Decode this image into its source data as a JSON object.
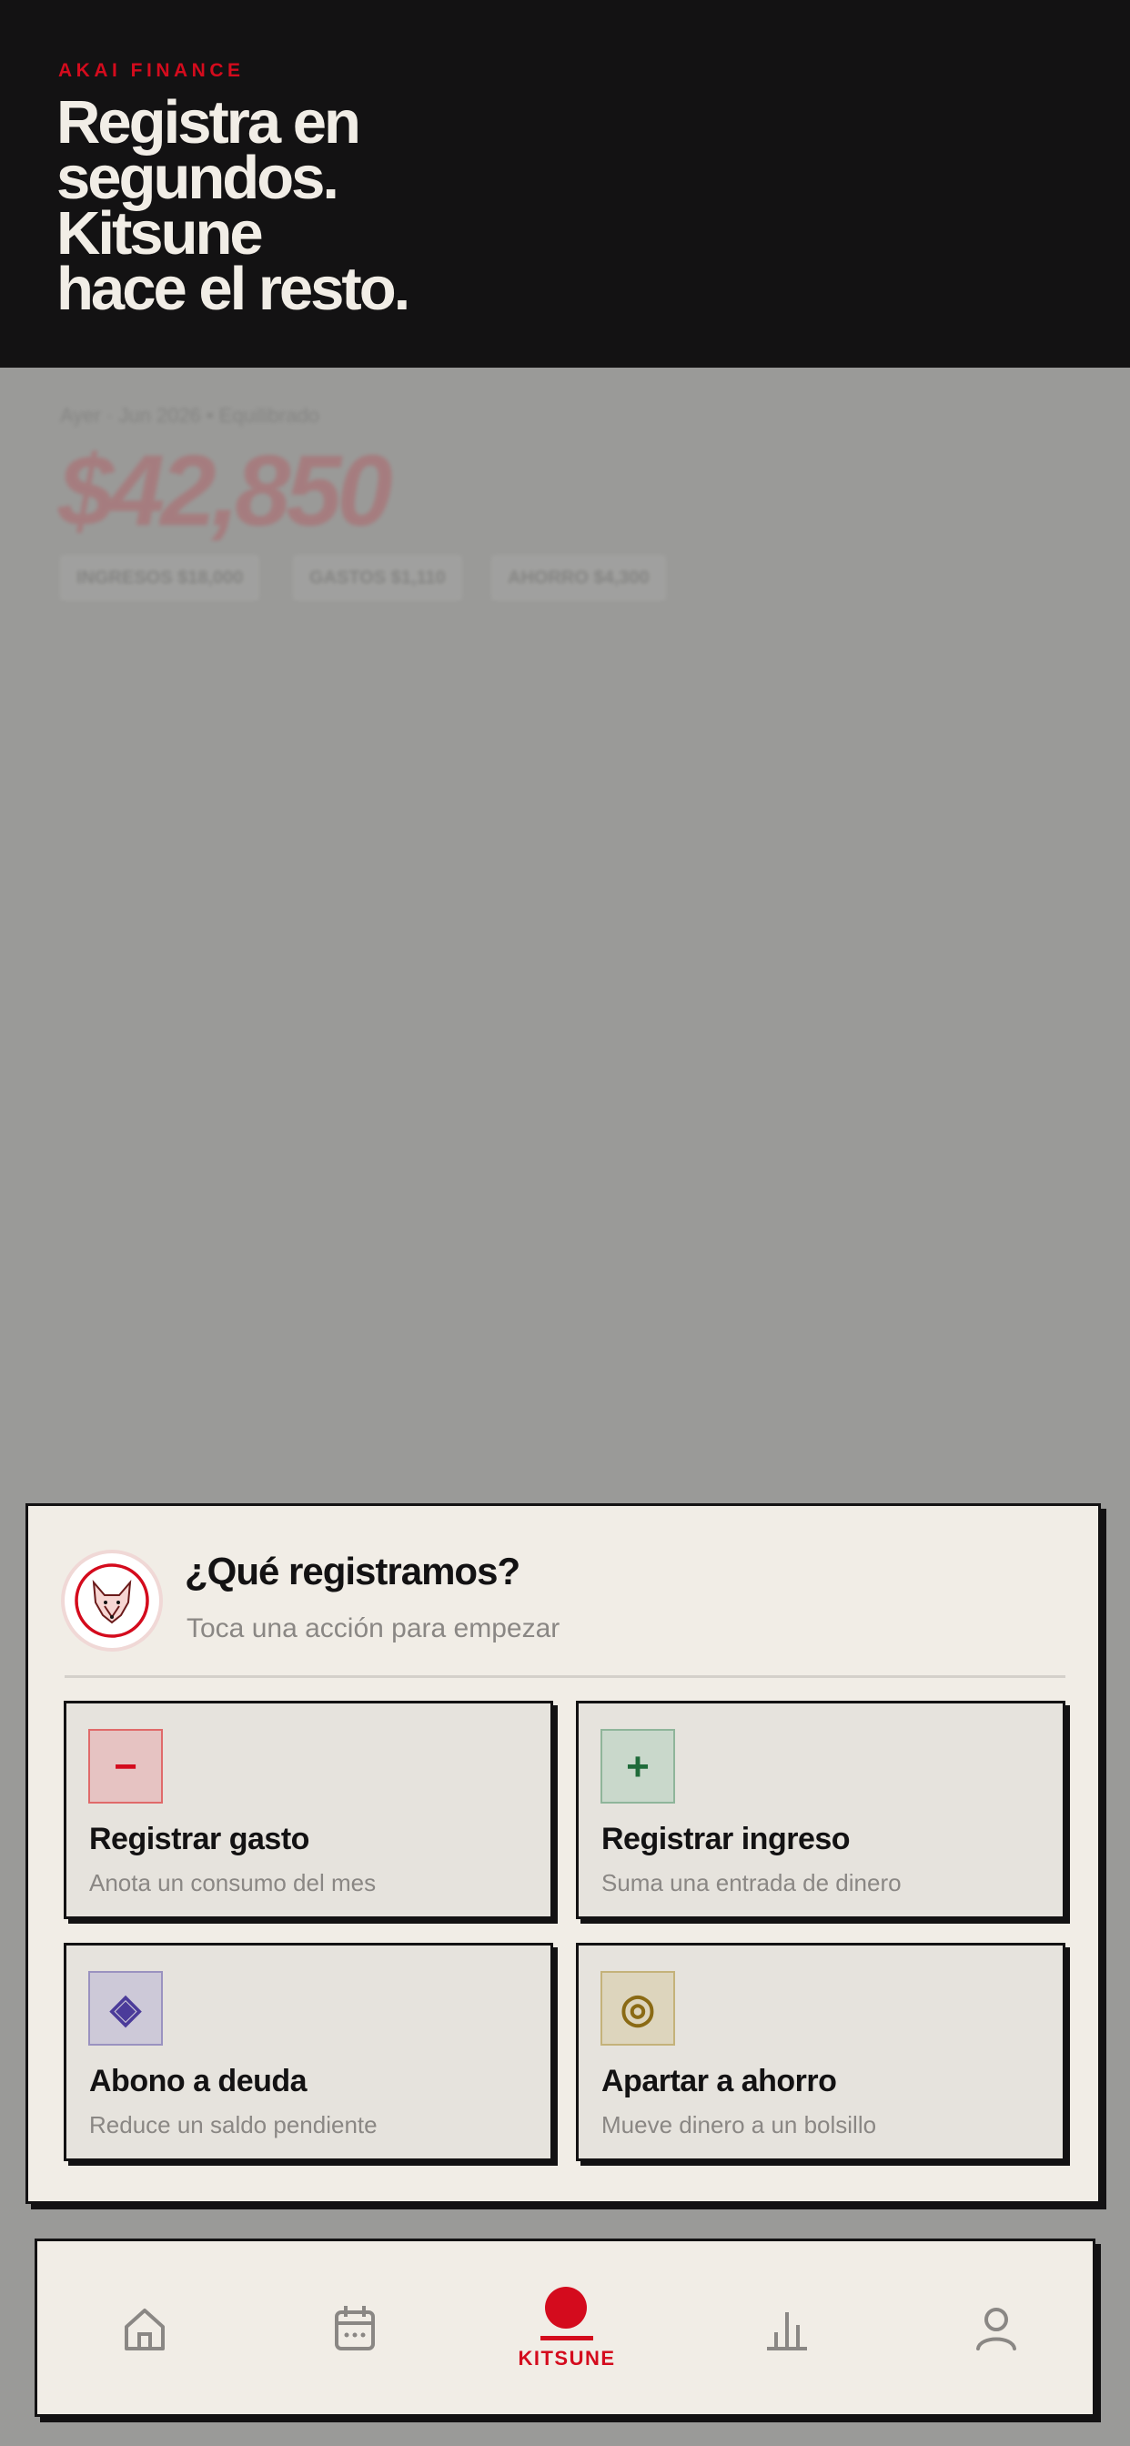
{
  "header": {
    "brand": "AKAI FINANCE",
    "headline_lines": [
      "Registra en",
      "segundos.",
      "Kitsune",
      "hace el resto."
    ]
  },
  "background": {
    "period": "Ayer · Jun 2026 • Equilibrado",
    "amount": "$42,850",
    "chips": [
      "INGRESOS $18,000",
      "GASTOS $1,110",
      "AHORRO $4,300"
    ]
  },
  "sheet": {
    "title": "¿Qué registramos?",
    "subtitle": "Toca una acción para empezar",
    "actions": [
      {
        "title": "Registrar gasto",
        "subtitle": "Anota un consumo del mes",
        "icon": "−",
        "icon_name": "minus-icon",
        "color": "#d40b1d",
        "bg": "#e6c3c2"
      },
      {
        "title": "Registrar ingreso",
        "subtitle": "Suma una entrada de dinero",
        "icon": "+",
        "icon_name": "plus-icon",
        "color": "#1f6b3a",
        "bg": "#c9d8cb"
      },
      {
        "title": "Abono a deuda",
        "subtitle": "Reduce un saldo pendiente",
        "icon": "◈",
        "icon_name": "diamond-icon",
        "color": "#4b3b9a",
        "bg": "#cdc9d8"
      },
      {
        "title": "Apartar a ahorro",
        "subtitle": "Mueve dinero a un bolsillo",
        "icon": "◎",
        "icon_name": "target-icon",
        "color": "#8a6a14",
        "bg": "#ddd5bd"
      }
    ]
  },
  "nav": {
    "items": [
      "home-icon",
      "calendar-icon",
      "kitsune",
      "chart-icon",
      "profile-icon"
    ],
    "center_label": "KITSUNE"
  },
  "colors": {
    "accent": "#d40b1d",
    "dark": "#131213",
    "paper": "#f1ede6"
  }
}
